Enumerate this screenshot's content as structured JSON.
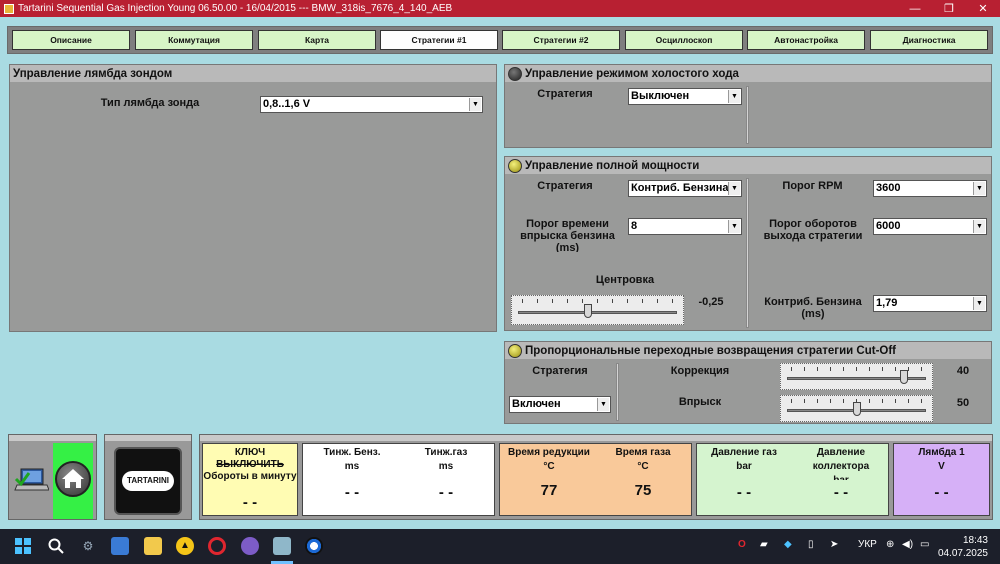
{
  "window": {
    "title": "Tartarini Sequential Gas Injection Young 06.50.00 - 16/04/2015 --- BMW_318is_7676_4_140_AEB",
    "minimize": "—",
    "maximize": "❐",
    "close": "✕"
  },
  "tabs": [
    {
      "label": "Описание"
    },
    {
      "label": "Коммутация"
    },
    {
      "label": "Карта"
    },
    {
      "label": "Стратегии #1"
    },
    {
      "label": "Стратегии #2"
    },
    {
      "label": "Осциллоскоп"
    },
    {
      "label": "Автонастройка"
    },
    {
      "label": "Диагностика"
    }
  ],
  "lambda_panel": {
    "title": "Управление лямбда зондом",
    "type_label": "Тип лямбда зонда",
    "type_value": "0,8..1,6 V"
  },
  "idle_panel": {
    "title": "Управление режимом холостого хода",
    "strategy_label": "Стратегия",
    "strategy_value": "Выключен"
  },
  "fullpower_panel": {
    "title": "Управление полной мощности",
    "strategy_label": "Стратегия",
    "strategy_value": "Контриб. Бензина",
    "inj_threshold_label": "Порог времени впрыска бензина (ms)",
    "inj_threshold_value": "8",
    "rpm_threshold_label": "Порог RPM",
    "rpm_threshold_value": "3600",
    "exit_rpm_label": "Порог оборотов выхода стратегии",
    "exit_rpm_value": "6000",
    "centering_label": "Центровка",
    "centering_value": "-0,25",
    "centering_fraction": 0.44,
    "petrol_contrib_label": "Контриб. Бензина (ms)",
    "petrol_contrib_value": "1,79"
  },
  "cutoff_panel": {
    "title": "Пропорциональные переходные возвращения стратегии Cut-Off",
    "strategy_label": "Стратегия",
    "strategy_value": "Включен",
    "correction_label": "Коррекция",
    "correction_value": "40",
    "correction_fraction": 0.86,
    "injection_label": "Впрыск",
    "injection_value": "50",
    "injection_fraction": 0.5
  },
  "status": {
    "key_title": "КЛЮЧ",
    "key_state": "ВЫКЛЮЧИТЬ",
    "rpm_label": "Обороты в минуту",
    "rpm_value": "- -",
    "tinj_petrol_label": "Тинж. Бенз.",
    "tinj_petrol_unit": "ms",
    "tinj_petrol_value": "- -",
    "tinj_gas_label": "Тинж.газ",
    "tinj_gas_unit": "ms",
    "tinj_gas_value": "- -",
    "reducer_time_label": "Время редукции",
    "reducer_unit": "°C",
    "reducer_value": "77",
    "gas_time_label": "Время газа",
    "gas_unit": "°C",
    "gas_value": "75",
    "gas_pressure_label": "Давление газ",
    "gas_pressure_unit": "bar",
    "gas_pressure_value": "- -",
    "manifold_pressure_label": "Давление коллектора",
    "manifold_pressure_unit": "bar",
    "manifold_pressure_value": "- -",
    "lambda1_label": "Лямбда 1",
    "lambda1_unit": "V",
    "lambda1_value": "- -"
  },
  "logo_text": "TARTARINI",
  "taskbar": {
    "lang": "УКР",
    "time": "18:43",
    "date": "04.07.2025"
  },
  "colors": {
    "titlebar": "#b82032",
    "background": "#a9dbe2",
    "panel": "#999a99",
    "tab": "#d7f5c7",
    "card_white": "#ffffff",
    "card_yellow": "#fffcb3",
    "card_orange": "#f9c99a",
    "card_green": "#d5f4cf",
    "card_purple": "#d6b0f7",
    "home_green": "#35f045"
  }
}
